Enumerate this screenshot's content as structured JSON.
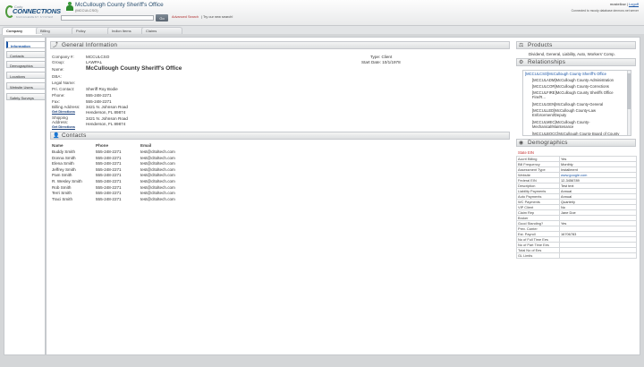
{
  "header": {
    "logo_small": "Cody",
    "logo_main": "CONNECTIONS",
    "logo_sub": "MANAGEMENT SYSTEM",
    "account_name": "McCullough County Sheriff's Office",
    "account_code": "(MCCULCSO)",
    "search_placeholder": "",
    "go_label": "Go",
    "advanced_search": "Advanced Search",
    "new_search": "| Try our new search!",
    "user": "mostellow |",
    "logoff": "Logoff",
    "connected": "Connected to mcody database dmmoro.net server"
  },
  "tabs": [
    "Company",
    "Billing",
    "Policy",
    "Indicn Items",
    "Claims"
  ],
  "nav": [
    "Information",
    "Contacts",
    "Demographics",
    "Locations",
    "Website Users",
    "Safety Surveys"
  ],
  "general": {
    "title": "General Information",
    "rows": [
      {
        "label": "Company #:",
        "value": "MCCULCSO"
      },
      {
        "label": "Group:",
        "value": "LAWPAL"
      },
      {
        "label": "Name:",
        "value": "McCullough County Sheriff's Office"
      },
      {
        "label": "DBA:",
        "value": ""
      },
      {
        "label": "Legal Name:",
        "value": ""
      },
      {
        "label": "Pri. Contact:",
        "value": "Sheriff Roy Bodie"
      },
      {
        "label": "Phone:",
        "value": "555-248-2271"
      },
      {
        "label": "Fax:",
        "value": "555-248-2271"
      }
    ],
    "billing_label": "Billing Address:",
    "billing_dl": "Get Directions",
    "billing_1": "3421 N. Johnson Road",
    "billing_2": "Henderson, FL 89874",
    "shipping_label": "Shipping Address:",
    "shipping_dl": "Get Directions",
    "shipping_1": "3421 N. Johnson Road",
    "shipping_2": "Henderson, FL 89874",
    "type": "Type: Client",
    "start_date": "Start Date: 10/1/1978"
  },
  "contacts": {
    "title": "Contacts",
    "headers": [
      "Name",
      "Phone",
      "Email"
    ],
    "rows": [
      [
        "Buddy Smith",
        "555-248-2271",
        "test@cltoltech.com"
      ],
      [
        "Donna Smith",
        "555-248-2271",
        "test@cltoltech.com"
      ],
      [
        "Elena Smith",
        "555-248-2271",
        "test@cltoltech.com"
      ],
      [
        "Jeffrey Smith",
        "555-248-2271",
        "test@cltoltech.com"
      ],
      [
        "Pam Smith",
        "555-248-2271",
        "test@cltoltech.com"
      ],
      [
        "R. Wesley Smith",
        "555-248-2271",
        "test@cltoltech.com"
      ],
      [
        "Rob Smith",
        "555-248-2271",
        "test@cltoltech.com"
      ],
      [
        "Terri Smith",
        "555-248-2271",
        "test@cltoltech.com"
      ],
      [
        "Traci Smith",
        "555-248-2271",
        "test@cltoltech.com"
      ]
    ]
  },
  "products": {
    "title": "Products",
    "text": "Dividend, General, Liability, Auto, Workers' Comp."
  },
  "relationships": {
    "title": "Relationships",
    "items": [
      "[MCCULCSO]McCullough County Sheriff's Office",
      "[MCCULADM]McCullough County-Administration",
      "[MCCULCOR]McCullough County-Corrections",
      "[MCCULFIRE]McCullough County Sheriffs Office Fire/R...",
      "[MCCULGEN]McCullough County-General",
      "[MCCULLED]McCullough County-Law Enforcement/Deputy",
      "[MCCULMEC]McCullough County-Mechanical/Maintenance",
      "[MCCULBOCC]McCullough County Board of County"
    ]
  },
  "demographics": {
    "title": "Demographics",
    "state_ein": "State EIN",
    "rows": [
      [
        "Accrrl Billing",
        "Yes"
      ],
      [
        "Bill Frequency",
        "Monthly"
      ],
      [
        "Assessment Type",
        "Installment"
      ],
      [
        "Website",
        "www.google.com"
      ],
      [
        "Federal EIN",
        "12-3456789"
      ],
      [
        "Description",
        "Test text"
      ],
      [
        "Liability Payments",
        "Annual"
      ],
      [
        "Auto Payments",
        "Annual"
      ],
      [
        "WC Payments",
        "Quarterly"
      ],
      [
        "VIP Client",
        "No"
      ],
      [
        "Claim Rep",
        "Jane Doe"
      ],
      [
        "Broker",
        ""
      ],
      [
        "Good Standing?",
        "Yes"
      ],
      [
        "Prev. Carrier",
        ""
      ],
      [
        "Est. Payroll",
        "16706783"
      ],
      [
        "No of Full Time Ees",
        ""
      ],
      [
        "No of Part Time Ees",
        ""
      ],
      [
        "Total No of Ees",
        ""
      ],
      [
        "GL Limits",
        ""
      ]
    ]
  },
  "colors": {
    "brand": "#184c7e",
    "accent_green": "#3c9b3c",
    "link": "#1a55a5",
    "alert": "#c43030"
  }
}
